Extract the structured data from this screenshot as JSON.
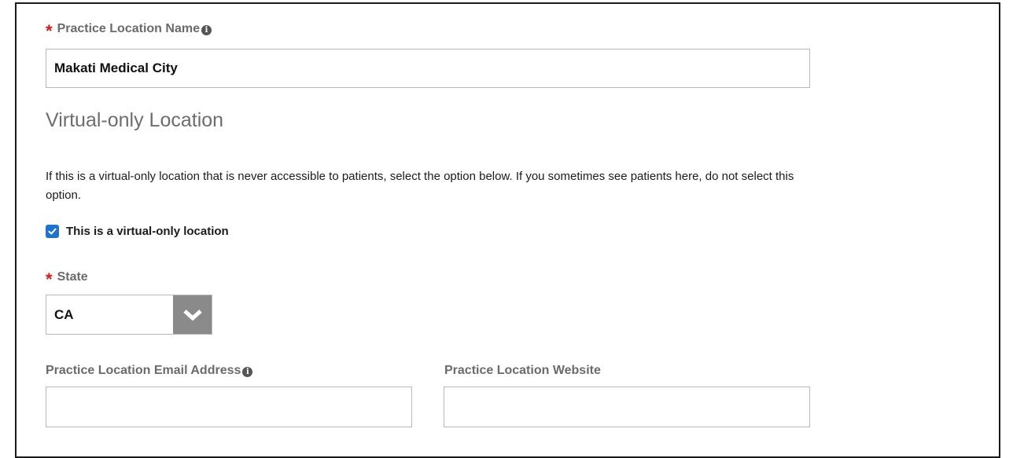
{
  "practice_location_name": {
    "required_mark": "*",
    "label": "Practice Location Name",
    "info_icon": "info-icon",
    "value": "Makati Medical City"
  },
  "virtual_section": {
    "heading": "Virtual-only Location",
    "description": "If this is a virtual-only location that is never accessible to patients, select the option below. If you sometimes see patients here, do not select this option.",
    "checkbox_label": "This is a virtual-only location",
    "checkbox_checked": true
  },
  "state": {
    "required_mark": "*",
    "label": "State",
    "selected": "CA",
    "dropdown_icon": "chevron-down-icon"
  },
  "email": {
    "label": "Practice Location Email Address",
    "info_icon": "info-icon",
    "value": ""
  },
  "website": {
    "label": "Practice Location Website",
    "value": ""
  },
  "colors": {
    "required": "#d6191b",
    "checkbox": "#1f74c9",
    "label_gray": "#6b6b6b",
    "select_button": "#8a8a8a"
  }
}
